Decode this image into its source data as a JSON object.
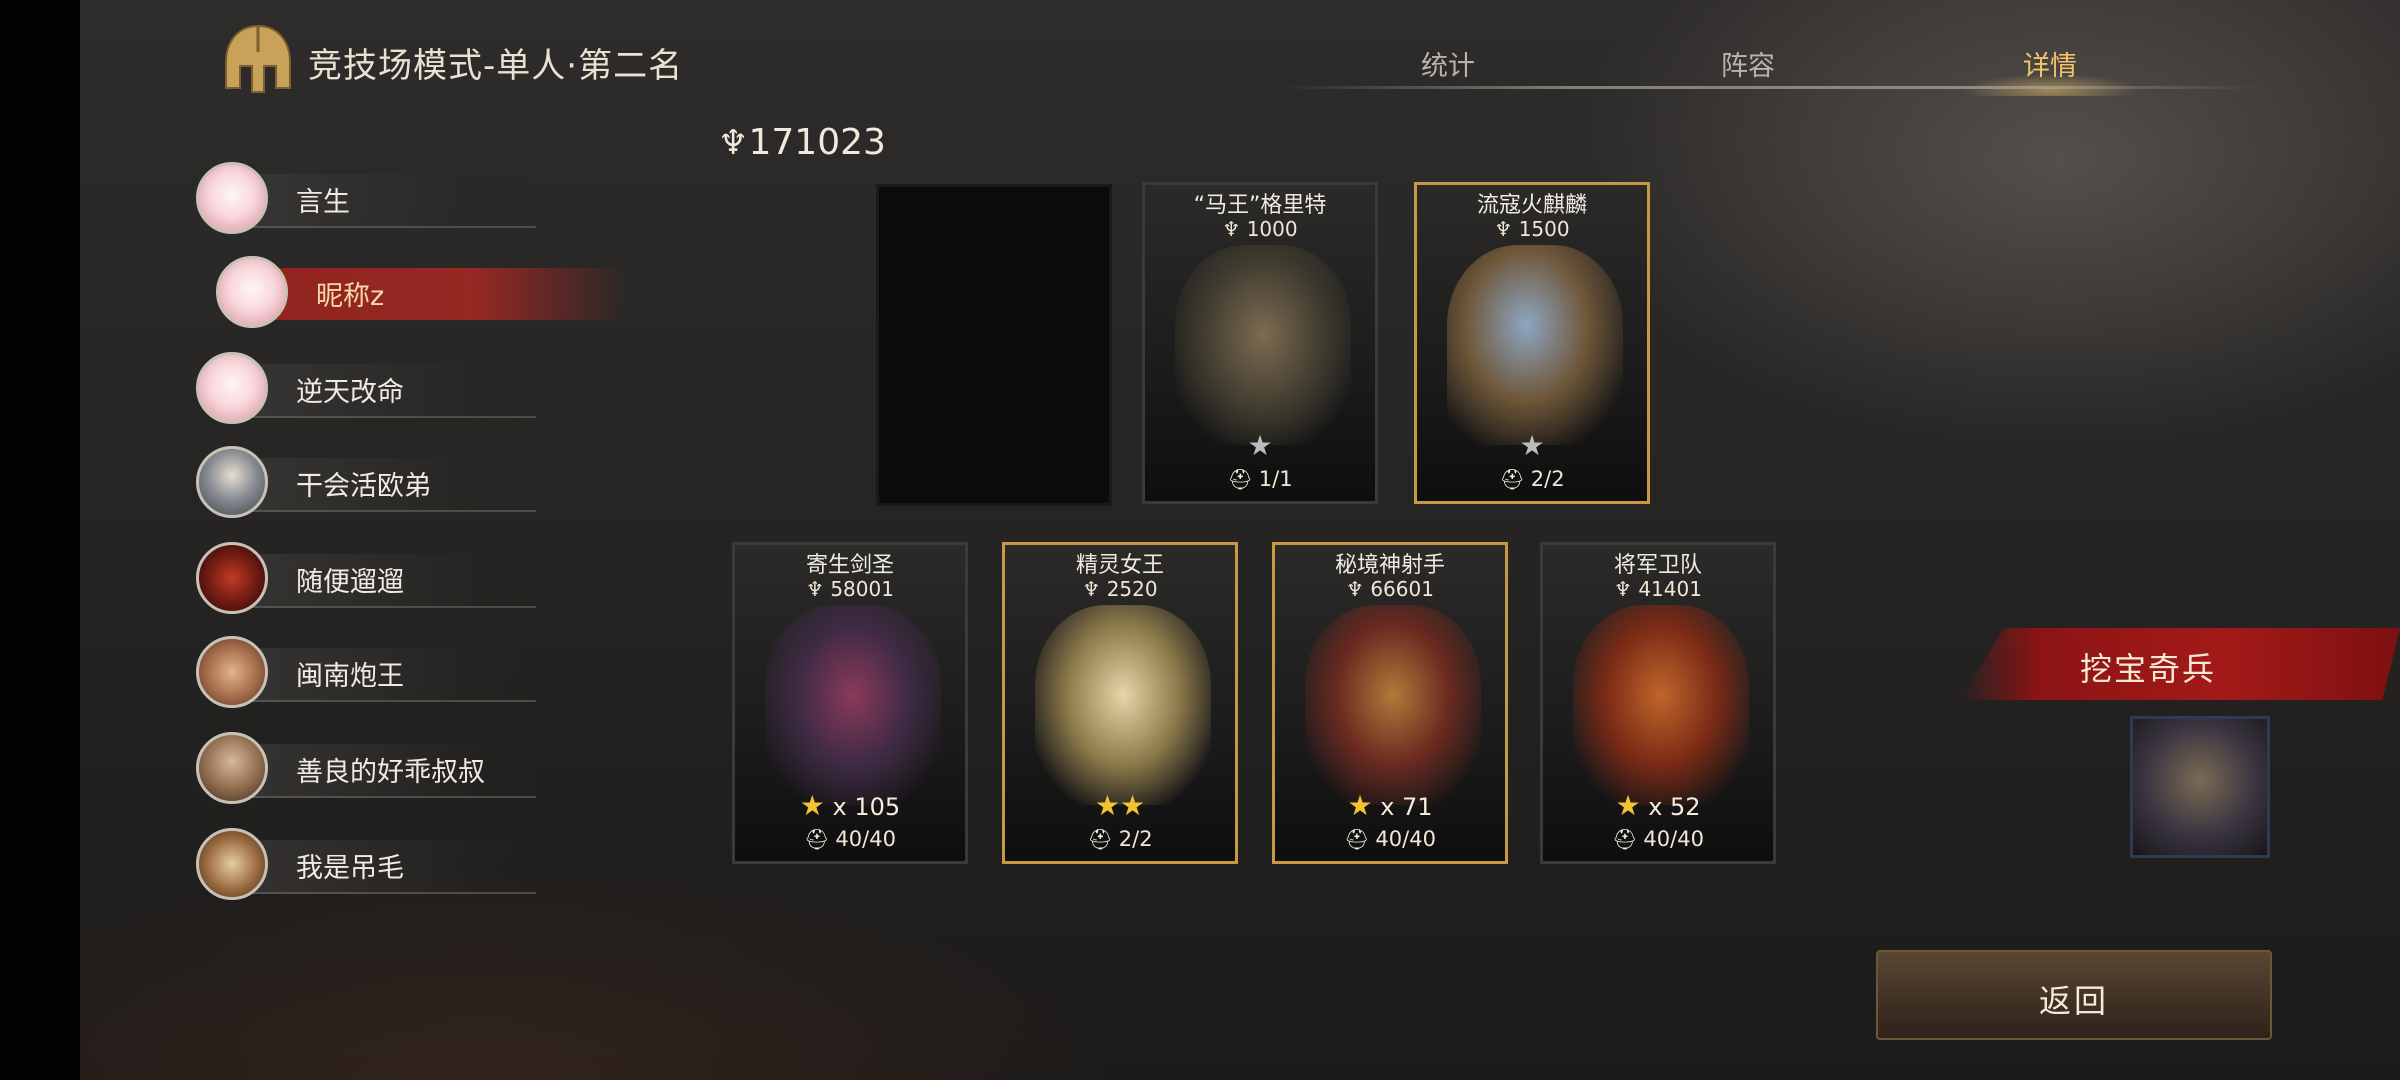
{
  "header": {
    "title": "竞技场模式-单人·第二名",
    "tabs": [
      {
        "label": "统计",
        "active": false
      },
      {
        "label": "阵容",
        "active": false
      },
      {
        "label": "详情",
        "active": true
      }
    ]
  },
  "players": [
    {
      "name": "言生",
      "avatar": "pink-cake-avatar",
      "selected": false
    },
    {
      "name": "昵称z",
      "avatar": "pink-cake-avatar",
      "selected": true
    },
    {
      "name": "逆天改命",
      "avatar": "pink-cake-avatar",
      "selected": false
    },
    {
      "name": "干会活欧弟",
      "avatar": "elf-avatar",
      "selected": false
    },
    {
      "name": "随便遛遛",
      "avatar": "demon-avatar",
      "selected": false
    },
    {
      "name": "闽南炮王",
      "avatar": "pig-avatar",
      "selected": false
    },
    {
      "name": "善良的好乖叔叔",
      "avatar": "man-avatar",
      "selected": false
    },
    {
      "name": "我是吊毛",
      "avatar": "warrior-avatar",
      "selected": false
    }
  ],
  "power": {
    "value": "171023"
  },
  "top_cards": [
    {
      "empty": true
    },
    {
      "name": "“马王”格里特",
      "power": "1000",
      "stars": "1",
      "star_color": "grey",
      "count": "1/1",
      "border": "dark"
    },
    {
      "name": "流寇火麒麟",
      "power": "1500",
      "stars": "1",
      "star_color": "grey",
      "count": "2/2",
      "border": "gold"
    }
  ],
  "bottom_cards": [
    {
      "name": "寄生剑圣",
      "power": "58001",
      "stars_text": "x 105",
      "count": "40/40",
      "border": "dark"
    },
    {
      "name": "精灵女王",
      "power": "2520",
      "stars_text": "",
      "star_count": 2,
      "count": "2/2",
      "border": "gold"
    },
    {
      "name": "秘境神射手",
      "power": "66601",
      "stars_text": "x 71",
      "count": "40/40",
      "border": "gold"
    },
    {
      "name": "将军卫队",
      "power": "41401",
      "stars_text": "x 52",
      "count": "40/40",
      "border": "dark"
    }
  ],
  "treasure": {
    "title": "挖宝奇兵"
  },
  "back_button": {
    "label": "返回"
  },
  "colors": {
    "accent_gold": "#c59a42",
    "selected_red": "#a31a18",
    "star_gold": "#f2c230"
  }
}
